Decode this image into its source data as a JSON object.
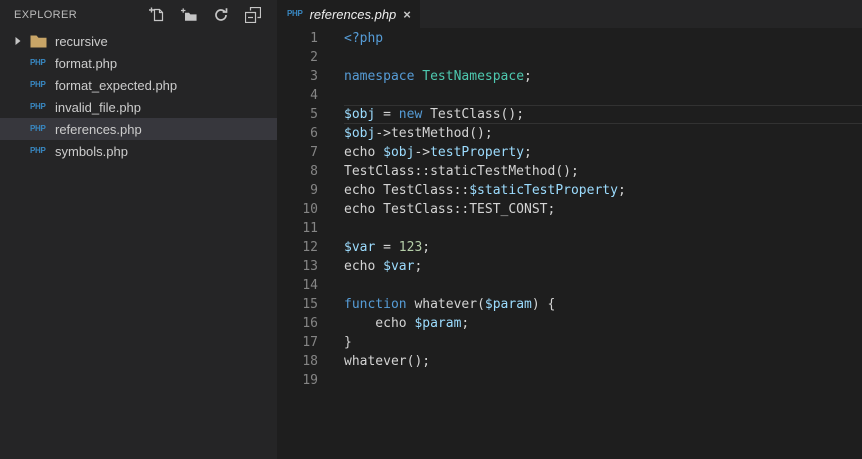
{
  "colors": {
    "keyword": "#569CD6",
    "class_name": "#4EC9B0",
    "variable": "#9CDCFE",
    "default_text": "#D4D4D4",
    "number": "#B5CEA8",
    "sidebar_bg": "#252526",
    "tabbar_bg": "#252526",
    "editor_bg": "#1E1E1E",
    "selection_bg": "#37373D",
    "line_number": "#858585",
    "line_highlight_border": "#323232",
    "icon_gray": "#C5C5C5",
    "php_icon_blue": "#3887C1",
    "folder_icon_tan": "#C8A567",
    "explorer_title": "#BBBBBB",
    "file_label": "#CCCCCC",
    "tab_label": "#EDEDED"
  },
  "sidebar": {
    "title": "EXPLORER",
    "php_badge": "PHP",
    "actions": [
      {
        "icon": "new-file-icon"
      },
      {
        "icon": "new-folder-icon"
      },
      {
        "icon": "refresh-icon"
      },
      {
        "icon": "collapse-all-icon"
      }
    ],
    "files": [
      {
        "name": "recursive",
        "kind": "folder",
        "selected": false,
        "expanded": false
      },
      {
        "name": "format.php",
        "kind": "php-file",
        "selected": false
      },
      {
        "name": "format_expected.php",
        "kind": "php-file",
        "selected": false
      },
      {
        "name": "invalid_file.php",
        "kind": "php-file",
        "selected": false
      },
      {
        "name": "references.php",
        "kind": "php-file",
        "selected": true
      },
      {
        "name": "symbols.php",
        "kind": "php-file",
        "selected": false
      }
    ]
  },
  "editor": {
    "tab": {
      "label": "references.php",
      "icon": "php-file-icon",
      "close_glyph": "×"
    },
    "active_line": 5,
    "code_lines": [
      {
        "num": 1,
        "tokens": [
          {
            "text": "<?php",
            "style": "keyword"
          }
        ]
      },
      {
        "num": 2,
        "tokens": []
      },
      {
        "num": 3,
        "tokens": [
          {
            "text": "namespace",
            "style": "keyword"
          },
          {
            "text": " ",
            "style": "default"
          },
          {
            "text": "TestNamespace",
            "style": "class"
          },
          {
            "text": ";",
            "style": "default"
          }
        ]
      },
      {
        "num": 4,
        "tokens": []
      },
      {
        "num": 5,
        "tokens": [
          {
            "text": "$obj",
            "style": "variable"
          },
          {
            "text": " = ",
            "style": "default"
          },
          {
            "text": "new",
            "style": "keyword"
          },
          {
            "text": " TestClass();",
            "style": "default"
          }
        ]
      },
      {
        "num": 6,
        "tokens": [
          {
            "text": "$obj",
            "style": "variable"
          },
          {
            "text": "->testMethod();",
            "style": "default"
          }
        ]
      },
      {
        "num": 7,
        "tokens": [
          {
            "text": "echo ",
            "style": "default"
          },
          {
            "text": "$obj",
            "style": "variable"
          },
          {
            "text": "->",
            "style": "default"
          },
          {
            "text": "testProperty",
            "style": "variable"
          },
          {
            "text": ";",
            "style": "default"
          }
        ]
      },
      {
        "num": 8,
        "tokens": [
          {
            "text": "TestClass::staticTestMethod();",
            "style": "default"
          }
        ]
      },
      {
        "num": 9,
        "tokens": [
          {
            "text": "echo TestClass::",
            "style": "default"
          },
          {
            "text": "$staticTestProperty",
            "style": "variable"
          },
          {
            "text": ";",
            "style": "default"
          }
        ]
      },
      {
        "num": 10,
        "tokens": [
          {
            "text": "echo TestClass::TEST_CONST;",
            "style": "default"
          }
        ]
      },
      {
        "num": 11,
        "tokens": []
      },
      {
        "num": 12,
        "tokens": [
          {
            "text": "$var",
            "style": "variable"
          },
          {
            "text": " = ",
            "style": "default"
          },
          {
            "text": "123",
            "style": "number"
          },
          {
            "text": ";",
            "style": "default"
          }
        ]
      },
      {
        "num": 13,
        "tokens": [
          {
            "text": "echo ",
            "style": "default"
          },
          {
            "text": "$var",
            "style": "variable"
          },
          {
            "text": ";",
            "style": "default"
          }
        ]
      },
      {
        "num": 14,
        "tokens": []
      },
      {
        "num": 15,
        "tokens": [
          {
            "text": "function",
            "style": "keyword"
          },
          {
            "text": " whatever(",
            "style": "default"
          },
          {
            "text": "$param",
            "style": "variable"
          },
          {
            "text": ") {",
            "style": "default"
          }
        ]
      },
      {
        "num": 16,
        "tokens": [
          {
            "text": "    echo ",
            "style": "default"
          },
          {
            "text": "$param",
            "style": "variable"
          },
          {
            "text": ";",
            "style": "default"
          }
        ]
      },
      {
        "num": 17,
        "tokens": [
          {
            "text": "}",
            "style": "default"
          }
        ]
      },
      {
        "num": 18,
        "tokens": [
          {
            "text": "whatever();",
            "style": "default"
          }
        ]
      },
      {
        "num": 19,
        "tokens": []
      }
    ]
  }
}
